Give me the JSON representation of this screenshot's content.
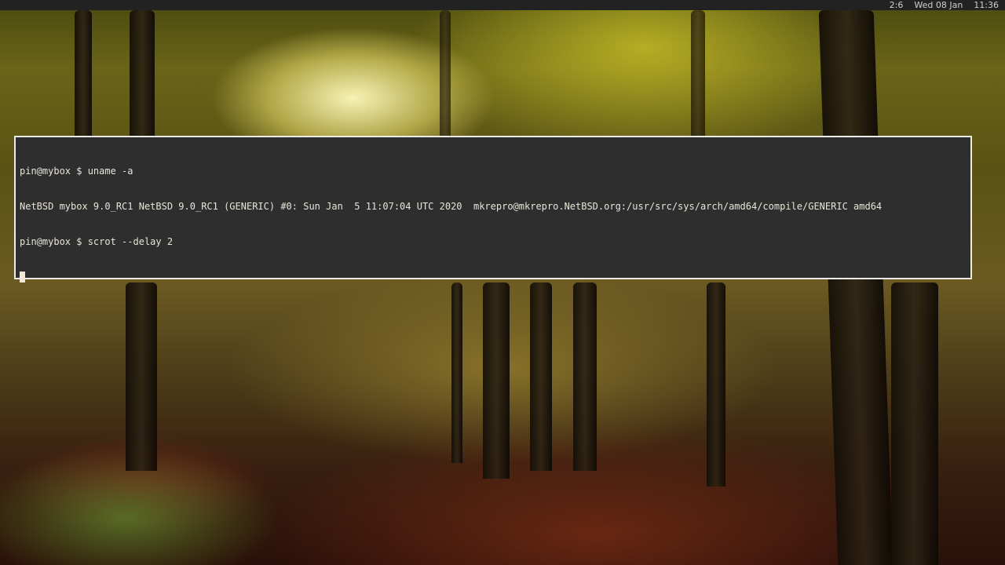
{
  "topbar": {
    "workspace": "2:6",
    "date": "Wed 08 Jan",
    "time": "11:36"
  },
  "terminal": {
    "lines": [
      "pin@mybox $ uname -a",
      "NetBSD mybox 9.0_RC1 NetBSD 9.0_RC1 (GENERIC) #0: Sun Jan  5 11:07:04 UTC 2020  mkrepro@mkrepro.NetBSD.org:/usr/src/sys/arch/amd64/compile/GENERIC amd64",
      "pin@mybox $ scrot --delay 2"
    ],
    "colors": {
      "background": "#2e2e2e",
      "foreground": "#e8e4d8",
      "border": "#ecebe6",
      "cursor": "#f4e7d8"
    }
  },
  "desktop": {
    "wallpaper": "forest-wallpaper"
  }
}
